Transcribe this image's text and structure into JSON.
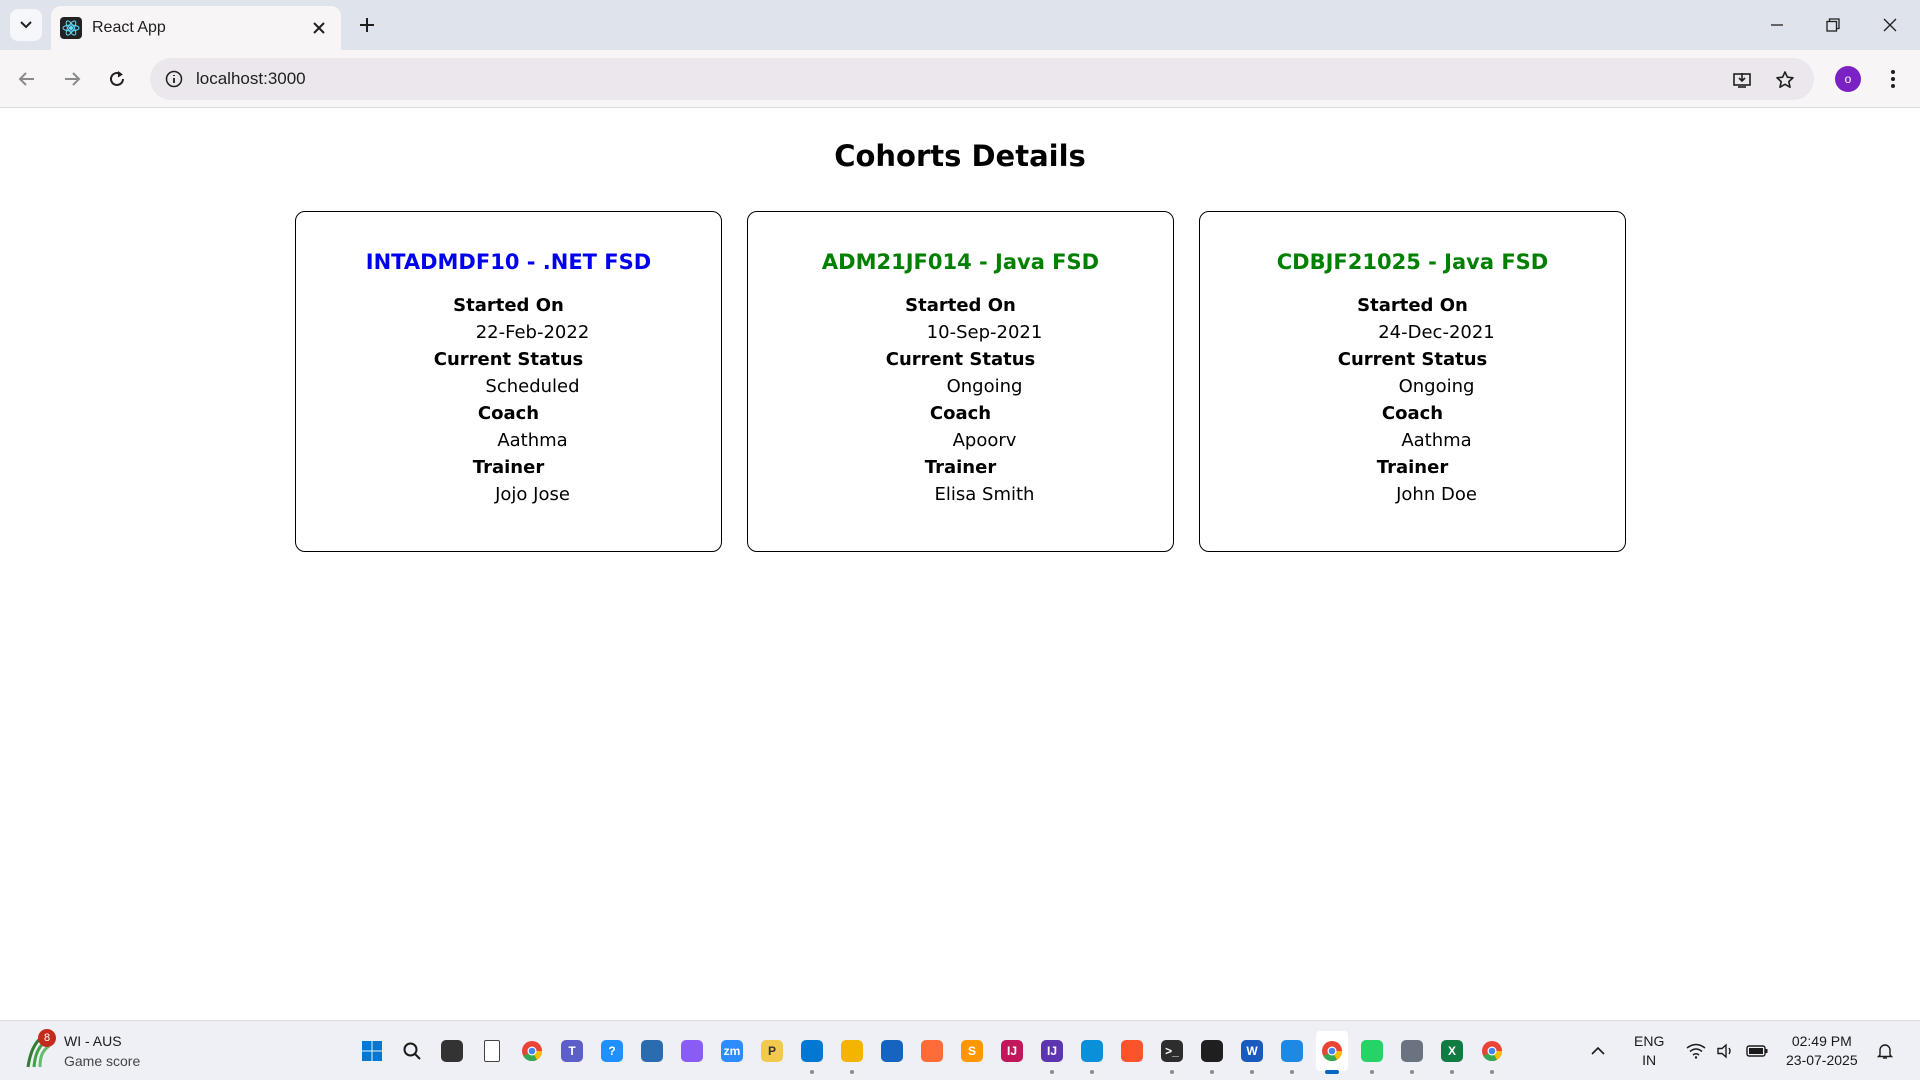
{
  "browser": {
    "tab_title": "React App",
    "url": "localhost:3000",
    "profile_initial": "o"
  },
  "page": {
    "title": "Cohorts Details",
    "labels": {
      "started_on": "Started On",
      "current_status": "Current Status",
      "coach": "Coach",
      "trainer": "Trainer"
    },
    "cohorts": [
      {
        "title": "INTADMDF10 - .NET FSD",
        "title_color": "#0000ee",
        "started_on": "22-Feb-2022",
        "current_status": "Scheduled",
        "coach": "Aathma",
        "trainer": "Jojo Jose"
      },
      {
        "title": "ADM21JF014 - Java FSD",
        "title_color": "#008000",
        "started_on": "10-Sep-2021",
        "current_status": "Ongoing",
        "coach": "Apoorv",
        "trainer": "Elisa Smith"
      },
      {
        "title": "CDBJF21025 - Java FSD",
        "title_color": "#008000",
        "started_on": "24-Dec-2021",
        "current_status": "Ongoing",
        "coach": "Aathma",
        "trainer": "John Doe"
      }
    ]
  },
  "taskbar": {
    "weather_badge": "8",
    "weather_title": "WI - AUS",
    "weather_subtitle": "Game score",
    "language": "ENG",
    "region": "IN",
    "time": "02:49 PM",
    "date": "23-07-2025",
    "apps": [
      {
        "name": "start",
        "icon": "windows-icon",
        "color": "#0078d4",
        "glyph": "",
        "running": false
      },
      {
        "name": "search",
        "icon": "search-icon",
        "color": "#eef0f5",
        "glyph": "",
        "running": false
      },
      {
        "name": "task-view",
        "icon": "task-view-icon",
        "color": "#333333",
        "glyph": "",
        "running": false
      },
      {
        "name": "notepad",
        "icon": "file-icon",
        "color": "#ffffff",
        "glyph": "",
        "running": false
      },
      {
        "name": "chrome",
        "icon": "chrome-icon",
        "color": "#34a853",
        "glyph": "",
        "running": false
      },
      {
        "name": "teams",
        "icon": "teams-icon",
        "color": "#5b5fc7",
        "glyph": "T",
        "running": false
      },
      {
        "name": "help",
        "icon": "help-icon",
        "color": "#1e90ff",
        "glyph": "?",
        "running": false
      },
      {
        "name": "network-app",
        "icon": "network-app-icon",
        "color": "#2b6cb0",
        "glyph": "",
        "running": false
      },
      {
        "name": "copilot",
        "icon": "copilot-icon",
        "color": "#8a5cf6",
        "glyph": "",
        "running": false
      },
      {
        "name": "zoom",
        "icon": "zoom-icon",
        "color": "#2d8cff",
        "glyph": "zm",
        "running": false
      },
      {
        "name": "postman",
        "icon": "postman-icon",
        "color": "#f2c94c",
        "glyph": "P",
        "running": false
      },
      {
        "name": "vscode",
        "icon": "vscode-icon",
        "color": "#0078d4",
        "glyph": "",
        "running": true
      },
      {
        "name": "file-explorer",
        "icon": "folder-icon",
        "color": "#f4b400",
        "glyph": "",
        "running": true
      },
      {
        "name": "store",
        "icon": "store-icon",
        "color": "#1565c0",
        "glyph": "",
        "running": false
      },
      {
        "name": "postman-orange",
        "icon": "rocket-icon",
        "color": "#ff6c37",
        "glyph": "",
        "running": false
      },
      {
        "name": "sublime",
        "icon": "sublime-icon",
        "color": "#ff9800",
        "glyph": "S",
        "running": false
      },
      {
        "name": "intellij",
        "icon": "intellij-icon",
        "color": "#c2185b",
        "glyph": "IJ",
        "running": false
      },
      {
        "name": "intellij-2",
        "icon": "intellij-icon",
        "color": "#5e35b1",
        "glyph": "IJ",
        "running": true
      },
      {
        "name": "edge",
        "icon": "edge-icon",
        "color": "#0a8fd9",
        "glyph": "",
        "running": true
      },
      {
        "name": "brave",
        "icon": "brave-icon",
        "color": "#fb542b",
        "glyph": "",
        "running": false
      },
      {
        "name": "terminal",
        "icon": "terminal-icon",
        "color": "#2d2d2d",
        "glyph": ">_",
        "running": true
      },
      {
        "name": "git",
        "icon": "git-icon",
        "color": "#1f1f1f",
        "glyph": "",
        "running": true
      },
      {
        "name": "word",
        "icon": "word-icon",
        "color": "#185abd",
        "glyph": "W",
        "running": true
      },
      {
        "name": "photos",
        "icon": "photos-icon",
        "color": "#1e88e5",
        "glyph": "",
        "running": true
      },
      {
        "name": "chrome-active",
        "icon": "chrome-icon",
        "color": "#34a853",
        "glyph": "",
        "running": true,
        "active": true
      },
      {
        "name": "whatsapp",
        "icon": "whatsapp-icon",
        "color": "#25d366",
        "glyph": "",
        "running": true
      },
      {
        "name": "settings",
        "icon": "gear-icon",
        "color": "#6b7280",
        "glyph": "",
        "running": true
      },
      {
        "name": "excel",
        "icon": "excel-icon",
        "color": "#107c41",
        "glyph": "X",
        "running": true
      },
      {
        "name": "chrome-2",
        "icon": "chrome-icon",
        "color": "#34a853",
        "glyph": "",
        "running": true
      }
    ]
  }
}
